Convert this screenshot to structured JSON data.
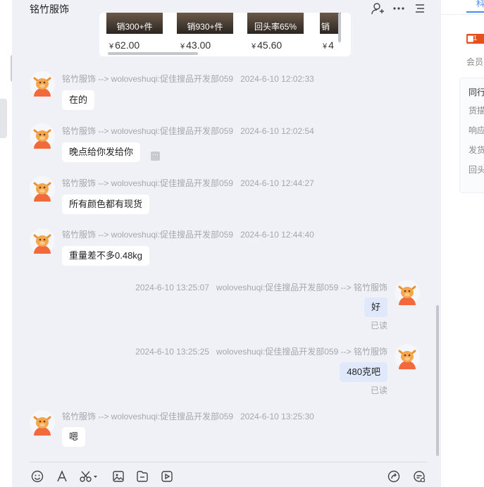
{
  "chat": {
    "title": "铭竹服饰",
    "products": [
      {
        "label": "销300+件",
        "price_symbol": "¥",
        "price": "62.00"
      },
      {
        "label": "销930+件",
        "price_symbol": "¥",
        "price": "43.00"
      },
      {
        "label": "回头率65%",
        "price_symbol": "¥",
        "price": "45.60"
      },
      {
        "label": "销",
        "price_symbol": "¥",
        "price": "4"
      }
    ],
    "messages": [
      {
        "direction": "in",
        "sender": "铭竹服饰 --> woloveshuqi:促佳搜品开发部059",
        "time": "2024-6-10 12:02:33",
        "text": "在的"
      },
      {
        "direction": "in",
        "sender": "铭竹服饰 --> woloveshuqi:促佳搜品开发部059",
        "time": "2024-6-10 12:02:54",
        "text": "晚点给你发给你"
      },
      {
        "direction": "in",
        "sender": "铭竹服饰 --> woloveshuqi:促佳搜品开发部059",
        "time": "2024-6-10 12:44:27",
        "text": "所有颜色都有现货"
      },
      {
        "direction": "in",
        "sender": "铭竹服饰 --> woloveshuqi:促佳搜品开发部059",
        "time": "2024-6-10 12:44:40",
        "text": "重量差不多0.48kg"
      },
      {
        "direction": "out",
        "sender": "woloveshuqi:促佳搜品开发部059 --> 铭竹服饰",
        "time": "2024-6-10 13:25:07",
        "text": "好",
        "status": "已读"
      },
      {
        "direction": "out",
        "sender": "woloveshuqi:促佳搜品开发部059 --> 铭竹服饰",
        "time": "2024-6-10 13:25:25",
        "text": "480克吧",
        "status": "已读"
      },
      {
        "direction": "in",
        "sender": "铭竹服饰 --> woloveshuqi:促佳搜品开发部059",
        "time": "2024-6-10 13:25:30",
        "text": "嗯"
      }
    ],
    "more_glyph": "···"
  },
  "sidebar": {
    "tab": "科",
    "badge": "1",
    "member": "会员",
    "rows": [
      "同行",
      "货描",
      "响应",
      "发货",
      "回头"
    ]
  },
  "colors": {
    "accent": "#4a8af4",
    "outgoing_bubble": "#dfe9fb",
    "chat_bg": "#f0f1f6",
    "badge": "#e8501b"
  },
  "icons": [
    "add-contact-icon",
    "more-icon",
    "menu-icon",
    "emoji-icon",
    "font-icon",
    "scissors-icon",
    "image-icon",
    "file-icon",
    "video-icon",
    "share-icon",
    "quick-reply-icon"
  ]
}
